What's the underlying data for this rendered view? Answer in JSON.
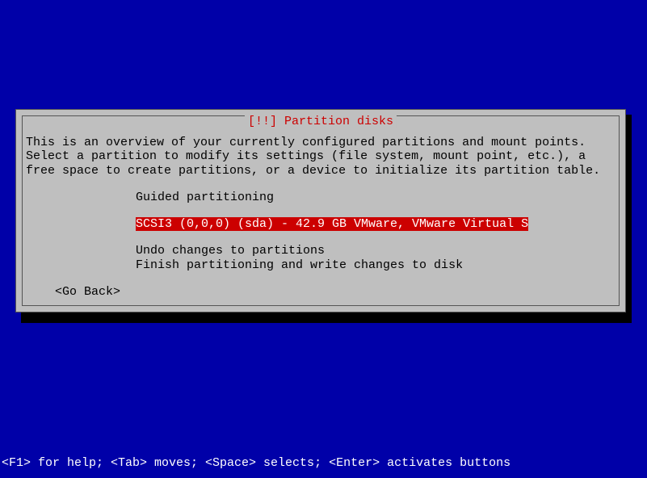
{
  "dialog": {
    "title": "[!!] Partition disks",
    "description": "This is an overview of your currently configured partitions and mount points. Select a partition to modify its settings (file system, mount point, etc.), a free space to create partitions, or a device to initialize its partition table.",
    "menu": {
      "guided": "Guided partitioning",
      "disk": "SCSI3 (0,0,0) (sda) - 42.9 GB VMware, VMware Virtual S",
      "undo": "Undo changes to partitions",
      "finish": "Finish partitioning and write changes to disk"
    },
    "goBack": "<Go Back>"
  },
  "helpBar": "<F1> for help; <Tab> moves; <Space> selects; <Enter> activates buttons"
}
